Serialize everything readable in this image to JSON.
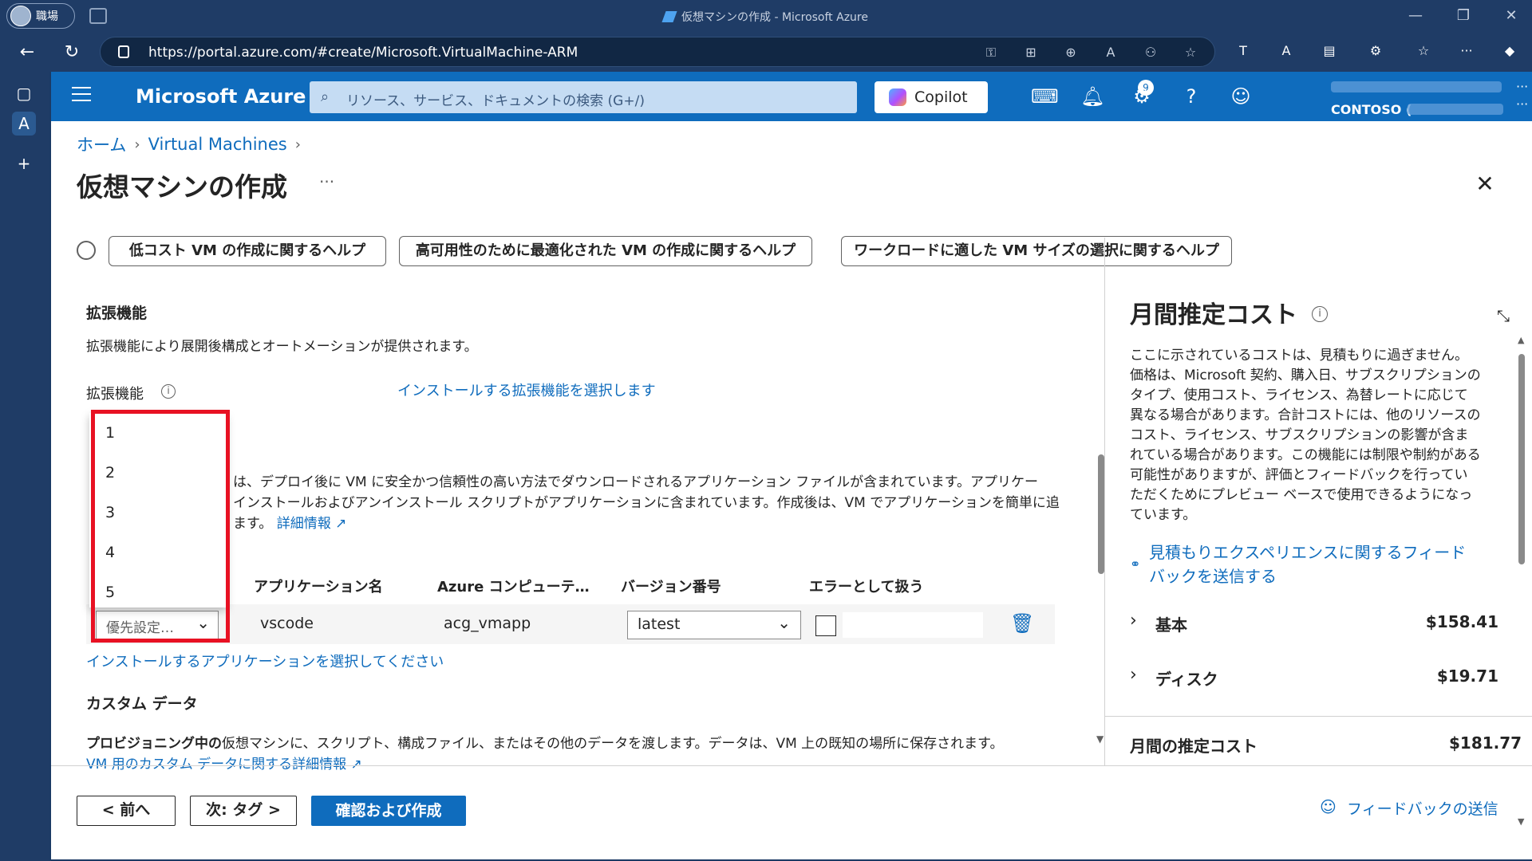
{
  "browser": {
    "profile_label": "職場",
    "window_title": "仮想マシンの作成 - Microsoft Azure",
    "url": "https://portal.azure.com/#create/Microsoft.VirtualMachine-ARM"
  },
  "azure_header": {
    "brand": "Microsoft Azure",
    "search_placeholder": "リソース、サービス、ドキュメントの検索 (G+/)",
    "copilot_label": "Copilot",
    "notification_count": "9",
    "account_label": "CONTOSO ("
  },
  "breadcrumb": {
    "home": "ホーム",
    "virtual_machines": "Virtual Machines"
  },
  "page": {
    "title": "仮想マシンの作成",
    "more": "···"
  },
  "help_buttons": [
    "低コスト VM の作成に関するヘルプ",
    "高可用性のために最適化された VM の作成に関するヘルプ",
    "ワークロードに適した VM サイズの選択に関するヘルプ"
  ],
  "extensions": {
    "title": "拡張機能",
    "description": "拡張機能により展開後構成とオートメーションが提供されます。",
    "field_label": "拡張機能",
    "select_link": "インストールする拡張機能を選択します"
  },
  "vm_apps": {
    "line1": "は、デプロイ後に VM に安全かつ信頼性の高い方法でダウンロードされるアプリケーション ファイルが含まれています。アプリケー",
    "line2": "インストールおよびアンインストール スクリプトがアプリケーションに含まれています。作成後は、VM でアプリケーションを簡単に追",
    "line3": "ます。",
    "more_link": "詳細情報",
    "columns": {
      "app_name": "アプリケーション名",
      "compute": "Azure コンピューテ…",
      "version": "バージョン番号",
      "treat_as_error": "エラーとして扱う"
    },
    "row": {
      "priority": "優先設定…",
      "app_name": "vscode",
      "compute": "acg_vmapp",
      "version": "latest"
    },
    "install_link": "インストールするアプリケーションを選択してください"
  },
  "priority_dropdown": {
    "options": [
      "1",
      "2",
      "3",
      "4",
      "5"
    ]
  },
  "custom_data": {
    "title": "カスタム データ",
    "desc_bold": "プロビジョニング中の",
    "desc_rest": "仮想マシンに、スクリプト、構成ファイル、またはその他のデータを渡します。データは、VM 上の既知の場所に保存されます。",
    "link": "VM 用のカスタム データに関する詳細情報"
  },
  "cost": {
    "title": "月間推定コスト",
    "description": "ここに示されているコストは、見積もりに過ぎません。価格は、Microsoft 契約、購入日、サブスクリプションのタイプ、使用コスト、ライセンス、為替レートに応じて異なる場合があります。合計コストには、他のリソースのコスト、ライセンス、サブスクリプションの影響が含まれている場合があります。この機能には制限や制約がある可能性がありますが、評価とフィードバックを行っていただくためにプレビュー ベースで使用できるようになっています。",
    "feedback_link": "見積もりエクスペリエンスに関するフィードバックを送信する",
    "rows": [
      {
        "label": "基本",
        "value": "$158.41"
      },
      {
        "label": "ディスク",
        "value": "$19.71"
      }
    ],
    "total_label": "月間の推定コスト",
    "total_value": "$181.77"
  },
  "footer": {
    "prev": "< 前へ",
    "next": "次: タグ >",
    "create": "確認および作成",
    "feedback": "フィードバックの送信"
  }
}
